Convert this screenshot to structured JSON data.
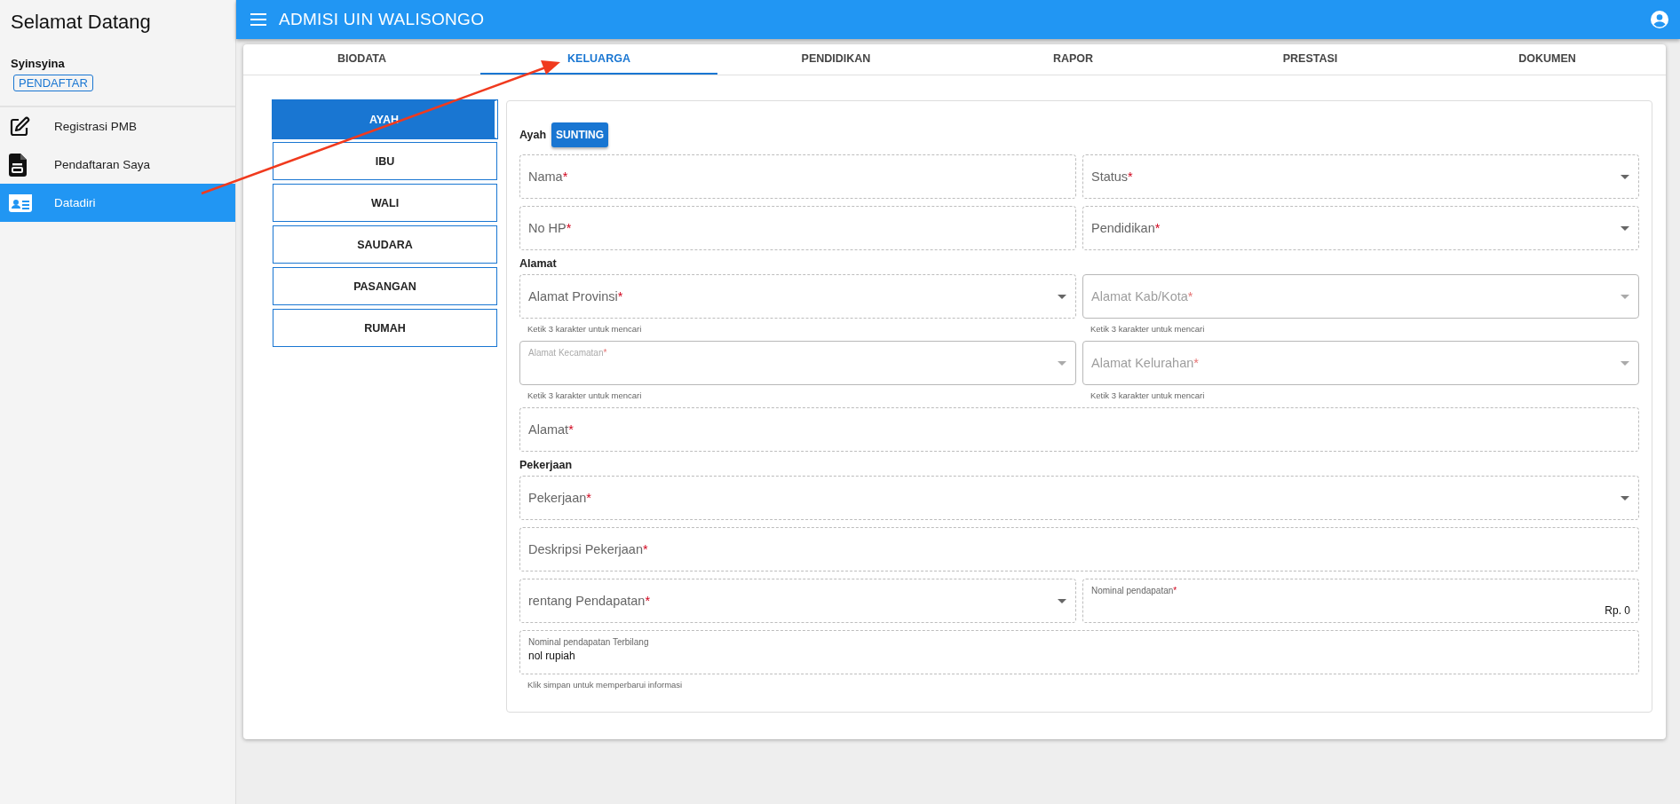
{
  "sidebar": {
    "title": "Selamat Datang",
    "user": "Syinsyina",
    "role": "PENDAFTAR",
    "items": [
      {
        "label": "Registrasi PMB",
        "selected": false
      },
      {
        "label": "Pendaftaran Saya",
        "selected": false
      },
      {
        "label": "Datadiri",
        "selected": true
      }
    ]
  },
  "header": {
    "title": "ADMISI UIN WALISONGO"
  },
  "tabs": [
    {
      "label": "BIODATA",
      "selected": false
    },
    {
      "label": "KELUARGA",
      "selected": true
    },
    {
      "label": "PENDIDIKAN",
      "selected": false
    },
    {
      "label": "RAPOR",
      "selected": false
    },
    {
      "label": "PRESTASI",
      "selected": false
    },
    {
      "label": "DOKUMEN",
      "selected": false
    }
  ],
  "members": [
    {
      "label": "AYAH",
      "selected": true
    },
    {
      "label": "IBU",
      "selected": false
    },
    {
      "label": "WALI",
      "selected": false
    },
    {
      "label": "SAUDARA",
      "selected": false
    },
    {
      "label": "PASANGAN",
      "selected": false
    },
    {
      "label": "RUMAH",
      "selected": false
    }
  ],
  "form": {
    "title": "Ayah",
    "edit_button": "SUNTING",
    "sections": [
      {
        "rows": [
          [
            {
              "kind": "text",
              "label": "Nama",
              "mark": "*",
              "disabled": false
            },
            {
              "kind": "select",
              "label": "Status",
              "mark": "*",
              "disabled": false
            }
          ],
          [
            {
              "kind": "text",
              "label": "No HP",
              "mark": "*",
              "disabled": false
            },
            {
              "kind": "select",
              "label": "Pendidikan",
              "mark": "*",
              "disabled": false
            }
          ]
        ]
      },
      {
        "heading": "Alamat",
        "rows": [
          [
            {
              "kind": "select",
              "label": "Alamat Provinsi",
              "mark": "*",
              "disabled": false,
              "hint": "Ketik 3 karakter untuk mencari"
            },
            {
              "kind": "select",
              "label": "Alamat Kab/Kota",
              "mark": "*",
              "disabled": true,
              "hint": "Ketik 3 karakter untuk mencari"
            }
          ],
          [
            {
              "kind": "select",
              "label": "Alamat Kecamatan",
              "mark": "*",
              "disabled": true,
              "floated": true,
              "hint": "Ketik 3 karakter untuk mencari"
            },
            {
              "kind": "select",
              "label": "Alamat Kelurahan",
              "mark": "*",
              "disabled": true,
              "hint": "Ketik 3 karakter untuk mencari"
            }
          ],
          [
            {
              "kind": "text",
              "label": "Alamat",
              "mark": "*",
              "disabled": false
            }
          ]
        ]
      },
      {
        "heading": "Pekerjaan",
        "rows": [
          [
            {
              "kind": "select",
              "label": "Pekerjaan",
              "mark": "*",
              "disabled": false
            }
          ],
          [
            {
              "kind": "text",
              "label": "Deskripsi Pekerjaan",
              "mark": "*",
              "disabled": false
            }
          ],
          [
            {
              "kind": "select",
              "label": "rentang Pendapatan",
              "mark": "*",
              "disabled": false
            },
            {
              "kind": "number",
              "label": "Nominal pendapatan",
              "mark": "*",
              "disabled": false,
              "floated": true,
              "value": "Rp. 0"
            }
          ],
          [
            {
              "kind": "text",
              "label": "Nominal pendapatan Terbilang",
              "disabled": false,
              "floated": true,
              "value": "nol rupiah",
              "hint": "Klik simpan untuk memperbarui informasi"
            }
          ]
        ]
      }
    ]
  }
}
